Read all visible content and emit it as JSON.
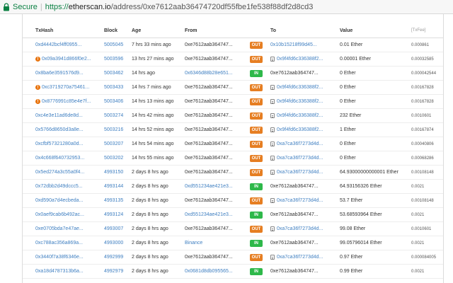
{
  "browser": {
    "secure_label": "Secure",
    "url_scheme": "https://",
    "url_host": "etherscan.io",
    "url_path": "/address/0xe7612aab36474720df55fbe1fe538f88df2d8cd3"
  },
  "table": {
    "headers": {
      "txhash": "TxHash",
      "block": "Block",
      "age": "Age",
      "from": "From",
      "to": "To",
      "value": "Value",
      "fee": "[TxFee]"
    },
    "rows": [
      {
        "hash": "0xd4442bcf4ff0955...",
        "hash_error": false,
        "block": "5005045",
        "age": "7 hrs 33 mins ago",
        "from": "0xe7612aab364747...",
        "from_link": false,
        "dir": "OUT",
        "to": "0x10b15218f99d45...",
        "to_contract": false,
        "to_link": true,
        "value": "0.01 Ether",
        "fee": "0.000861"
      },
      {
        "hash": "0x09a3941d866f0e2...",
        "hash_error": true,
        "block": "5003596",
        "age": "13 hrs 27 mins ago",
        "from": "0xe7612aab364747...",
        "from_link": false,
        "dir": "OUT",
        "to": "0x9f4fd6c336388f2...",
        "to_contract": true,
        "to_link": true,
        "value": "0.00001 Ether",
        "fee": "0.00032585"
      },
      {
        "hash": "0x8ba6e3591576d9...",
        "hash_error": false,
        "block": "5003462",
        "age": "14 hrs ago",
        "from": "0x6346d88b28e651...",
        "from_link": true,
        "dir": "IN",
        "to": "0xe7612aab364747...",
        "to_contract": false,
        "to_link": false,
        "value": "0 Ether",
        "fee": "0.000042544"
      },
      {
        "hash": "0xc3719270a75461...",
        "hash_error": true,
        "block": "5003433",
        "age": "14 hrs 7 mins ago",
        "from": "0xe7612aab364747...",
        "from_link": false,
        "dir": "OUT",
        "to": "0x9f4fd6c336388f2...",
        "to_contract": true,
        "to_link": true,
        "value": "0 Ether",
        "fee": "0.00167828"
      },
      {
        "hash": "0x8776991c85e4e7f...",
        "hash_error": true,
        "block": "5003406",
        "age": "14 hrs 13 mins ago",
        "from": "0xe7612aab364747...",
        "from_link": false,
        "dir": "OUT",
        "to": "0x9f4fd6c336388f2...",
        "to_contract": true,
        "to_link": true,
        "value": "0 Ether",
        "fee": "0.00167828"
      },
      {
        "hash": "0xc4e3e11ad6de8d...",
        "hash_error": false,
        "block": "5003274",
        "age": "14 hrs 42 mins ago",
        "from": "0xe7612aab364747...",
        "from_link": false,
        "dir": "OUT",
        "to": "0x9f4fd6c336388f2...",
        "to_contract": true,
        "to_link": true,
        "value": "232 Ether",
        "fee": "0.0010601"
      },
      {
        "hash": "0x5766d8650d3a8e...",
        "hash_error": false,
        "block": "5003216",
        "age": "14 hrs 52 mins ago",
        "from": "0xe7612aab364747...",
        "from_link": false,
        "dir": "OUT",
        "to": "0x9f4fd6c336388f2...",
        "to_contract": true,
        "to_link": true,
        "value": "1 Ether",
        "fee": "0.00167874"
      },
      {
        "hash": "0xcfbf57321280a0d...",
        "hash_error": false,
        "block": "5003207",
        "age": "14 hrs 54 mins ago",
        "from": "0xe7612aab364747...",
        "from_link": false,
        "dir": "OUT",
        "to": "0xa7ca36f7273d4d...",
        "to_contract": true,
        "to_link": true,
        "value": "0 Ether",
        "fee": "0.00040806"
      },
      {
        "hash": "0x4c668f640732953...",
        "hash_error": false,
        "block": "5003202",
        "age": "14 hrs 55 mins ago",
        "from": "0xe7612aab364747...",
        "from_link": false,
        "dir": "OUT",
        "to": "0xa7ca36f7273d4d...",
        "to_contract": true,
        "to_link": true,
        "value": "0 Ether",
        "fee": "0.00068286"
      },
      {
        "hash": "0x5ed274a3c55a0f4...",
        "hash_error": false,
        "block": "4993150",
        "age": "2 days 8 hrs ago",
        "from": "0xe7612aab364747...",
        "from_link": false,
        "dir": "OUT",
        "to": "0xa7ca36f7273d4d...",
        "to_contract": true,
        "to_link": true,
        "value": "64.93000000000001 Ether",
        "fee": "0.00108148"
      },
      {
        "hash": "0x72dbb2d49dccc5...",
        "hash_error": false,
        "block": "4993144",
        "age": "2 days 8 hrs ago",
        "from": "0xd551234ae421e3...",
        "from_link": true,
        "dir": "IN",
        "to": "0xe7612aab364747...",
        "to_contract": false,
        "to_link": false,
        "value": "64.93156326 Ether",
        "fee": "0.0021"
      },
      {
        "hash": "0xd590a7d4ecbeda...",
        "hash_error": false,
        "block": "4993135",
        "age": "2 days 8 hrs ago",
        "from": "0xe7612aab364747...",
        "from_link": false,
        "dir": "OUT",
        "to": "0xa7ca36f7273d4d...",
        "to_contract": true,
        "to_link": true,
        "value": "53.7 Ether",
        "fee": "0.00108148"
      },
      {
        "hash": "0x0aef9cab6b492ac...",
        "hash_error": false,
        "block": "4993124",
        "age": "2 days 8 hrs ago",
        "from": "0xd551234ae421e3...",
        "from_link": true,
        "dir": "IN",
        "to": "0xe7612aab364747...",
        "to_contract": false,
        "to_link": false,
        "value": "53.68593964 Ether",
        "fee": "0.0021"
      },
      {
        "hash": "0xe0705bda7e47ae...",
        "hash_error": false,
        "block": "4993007",
        "age": "2 days 8 hrs ago",
        "from": "0xe7612aab364747...",
        "from_link": false,
        "dir": "OUT",
        "to": "0xa7ca36f7273d4d...",
        "to_contract": true,
        "to_link": true,
        "value": "99.08 Ether",
        "fee": "0.0010601"
      },
      {
        "hash": "0xc788ac356a869a...",
        "hash_error": false,
        "block": "4993000",
        "age": "2 days 8 hrs ago",
        "from": "Binance",
        "from_link": true,
        "dir": "IN",
        "to": "0xe7612aab364747...",
        "to_contract": false,
        "to_link": false,
        "value": "99.05796014 Ether",
        "fee": "0.0021"
      },
      {
        "hash": "0x3440f7a38f6346e...",
        "hash_error": false,
        "block": "4992999",
        "age": "2 days 8 hrs ago",
        "from": "0xe7612aab364747...",
        "from_link": false,
        "dir": "OUT",
        "to": "0xa7ca36f7273d4d...",
        "to_contract": true,
        "to_link": true,
        "value": "0.97 Ether",
        "fee": "0.000084005"
      },
      {
        "hash": "0xa18d4787313b6a...",
        "hash_error": false,
        "block": "4992979",
        "age": "2 days 8 hrs ago",
        "from": "0x0681d8db095565...",
        "from_link": true,
        "dir": "IN",
        "to": "0xe7612aab364747...",
        "to_contract": false,
        "to_link": false,
        "value": "0.99 Ether",
        "fee": "0.0021"
      }
    ]
  }
}
